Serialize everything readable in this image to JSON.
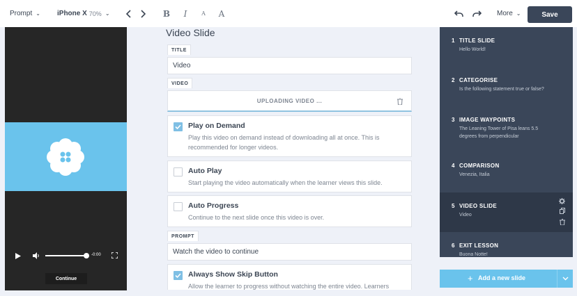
{
  "toolbar": {
    "prompt_label": "Prompt",
    "device_label": "iPhone X",
    "zoom": "70%",
    "more_label": "More",
    "save_label": "Save"
  },
  "preview": {
    "time": "-0:00",
    "continue_label": "Continue"
  },
  "editor": {
    "heading": "Video Slide",
    "title_tag": "TITLE",
    "title_value": "Video",
    "video_tag": "VIDEO",
    "upload_status": "UPLOADING VIDEO ...",
    "options": [
      {
        "title": "Play on Demand",
        "desc": "Play this video on demand instead of downloading all at once. This is recommended for longer videos.",
        "checked": true
      },
      {
        "title": "Auto Play",
        "desc": "Start playing the video automatically when the learner views this slide.",
        "checked": false
      },
      {
        "title": "Auto Progress",
        "desc": "Continue to the next slide once this video is over.",
        "checked": false
      }
    ],
    "prompt_tag": "PROMPT",
    "prompt_value": "Watch the video to continue",
    "skip": {
      "title": "Always Show Skip Button",
      "desc": "Allow the learner to progress without watching the entire video. Learners",
      "checked": true
    }
  },
  "slides": [
    {
      "num": "1",
      "title": "TITLE SLIDE",
      "sub": "Hello World!"
    },
    {
      "num": "2",
      "title": "CATEGORISE",
      "sub": "Is the following statement true or false?"
    },
    {
      "num": "3",
      "title": "IMAGE WAYPOINTS",
      "sub": "The Leaning Tower of Pisa leans 5.5 degrees from perpendicular"
    },
    {
      "num": "4",
      "title": "COMPARISON",
      "sub": "Venezia, Italia"
    },
    {
      "num": "5",
      "title": "VIDEO SLIDE",
      "sub": "Video"
    },
    {
      "num": "6",
      "title": "EXIT LESSON",
      "sub": "Buona Notte!"
    }
  ],
  "add_slide_label": "Add a new slide",
  "colors": {
    "accent": "#6ac3ec",
    "navy": "#3a4659",
    "selected": "#2e3848"
  }
}
